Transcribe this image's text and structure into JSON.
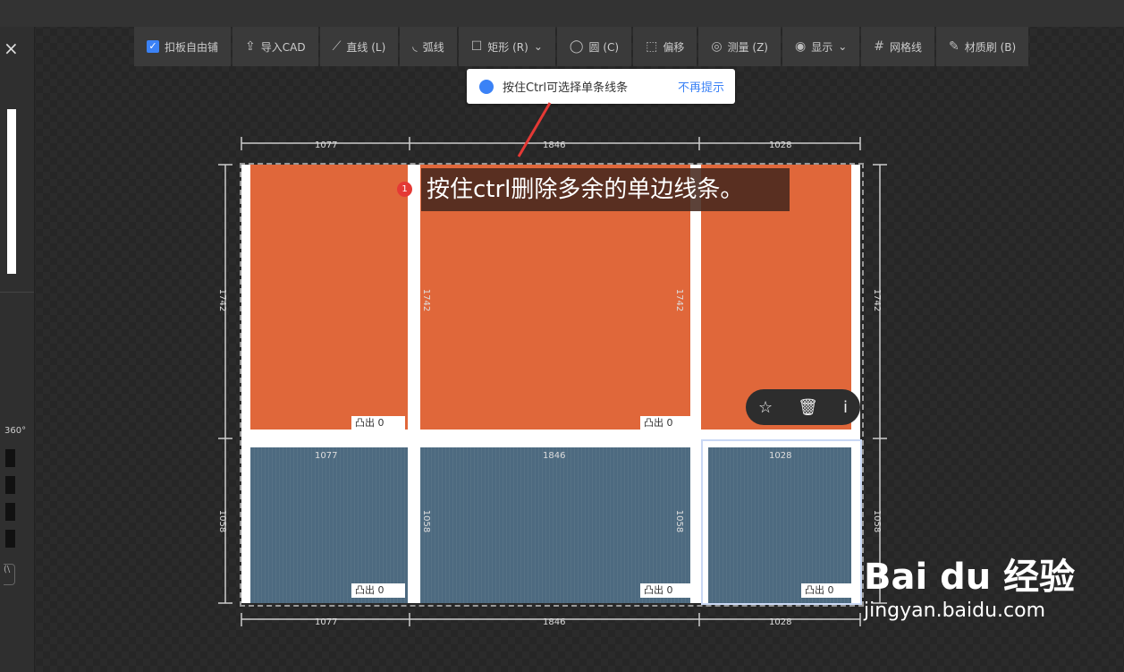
{
  "leftpanel": {
    "close": "×",
    "rotate_label": "360°",
    "bracket": "(\\"
  },
  "toolbar": {
    "items": [
      {
        "label": "扣板自由铺",
        "icon": "checkbox-checked-icon"
      },
      {
        "label": "导入CAD",
        "icon": "import-icon"
      },
      {
        "label": "直线 (L)",
        "icon": "line-icon"
      },
      {
        "label": "弧线",
        "icon": "arc-icon"
      },
      {
        "label": "矩形 (R)",
        "icon": "rectangle-icon"
      },
      {
        "label": "圆 (C)",
        "icon": "circle-icon"
      },
      {
        "label": "偏移",
        "icon": "offset-icon"
      },
      {
        "label": "测量 (Z)",
        "icon": "measure-icon"
      },
      {
        "label": "显示",
        "icon": "eye-icon"
      },
      {
        "label": "网格线",
        "icon": "grid-icon"
      },
      {
        "label": "材质刷 (B)",
        "icon": "brush-icon"
      }
    ]
  },
  "tip": {
    "text": "按住Ctrl可选择单条线条",
    "link": "不再提示"
  },
  "callout": {
    "badge": "1",
    "text": "按住ctrl删除多余的单边线条。"
  },
  "dims": {
    "top": [
      "1077",
      "1846",
      "1028"
    ],
    "mid": [
      "1077",
      "1846",
      "1028"
    ],
    "bottom": [
      "1077",
      "1846",
      "1028"
    ],
    "top_v": [
      "1742",
      "1742",
      "1742",
      "1742"
    ],
    "bottom_v": [
      "1058",
      "1058",
      "1058",
      "1058"
    ]
  },
  "panels": {
    "tag_label": "凸出 0"
  },
  "mini_toolbar": {
    "star": "☆",
    "trash": "🗑",
    "info": "i"
  },
  "watermark": {
    "brand": "Bai du 经验",
    "url": "jingyan.baidu.com"
  },
  "colors": {
    "orange": "#e0673a",
    "blue": "#4d6a80",
    "accent": "#3b82f6"
  }
}
